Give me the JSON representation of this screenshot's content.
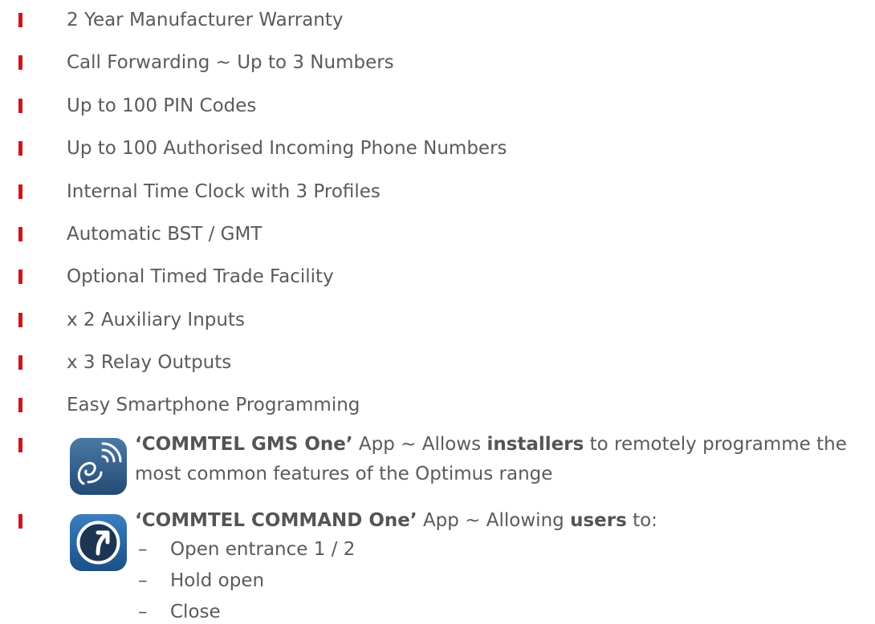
{
  "colors": {
    "bullet": "#d3141b",
    "text": "#5a5a5a",
    "gms_icon": "#2d5b86",
    "command_icon": "#1f6aa8"
  },
  "features": [
    "2 Year Manufacturer Warranty",
    "Call Forwarding ~ Up to 3 Numbers",
    "Up to 100 PIN Codes",
    "Up to 100 Authorised Incoming Phone Numbers",
    "Internal Time Clock with 3 Profiles",
    "Automatic BST / GMT",
    "Optional Timed Trade Facility",
    "x 2 Auxiliary Inputs",
    "x 3 Relay Outputs",
    "Easy Smartphone Programming"
  ],
  "apps": {
    "gms_one": {
      "icon": "commtel-gms-one-app-icon",
      "name": "‘COMMTEL GMS One’",
      "text_a": " App ~ Allows ",
      "emphasis": "installers",
      "text_b": " to remotely programme the",
      "line2": "most common features of the Optimus range"
    },
    "command_one": {
      "icon": "commtel-command-one-app-icon",
      "name": "‘COMMTEL COMMAND One’",
      "text_a": " App ~ Allowing ",
      "emphasis": "users",
      "text_b": " to:",
      "dash": "–",
      "sub_items": [
        "Open entrance 1 / 2",
        "Hold open",
        "Close"
      ]
    }
  }
}
